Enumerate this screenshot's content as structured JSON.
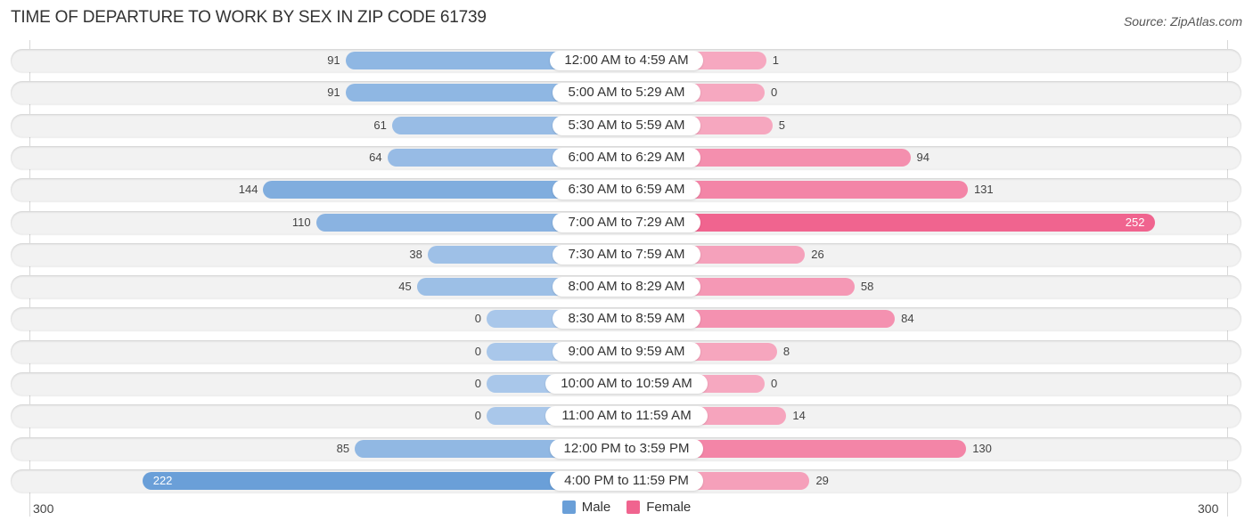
{
  "header": {
    "title": "TIME OF DEPARTURE TO WORK BY SEX IN ZIP CODE 61739",
    "source": "Source: ZipAtlas.com"
  },
  "colors": {
    "male": "#6a9fd8",
    "male_light": "#a9c7ea",
    "female": "#f0648f",
    "female_light": "#f6a8c0"
  },
  "chart_data": {
    "type": "bar",
    "orientation": "horizontal-diverging",
    "title": "TIME OF DEPARTURE TO WORK BY SEX IN ZIP CODE 61739",
    "categories": [
      "12:00 AM to 4:59 AM",
      "5:00 AM to 5:29 AM",
      "5:30 AM to 5:59 AM",
      "6:00 AM to 6:29 AM",
      "6:30 AM to 6:59 AM",
      "7:00 AM to 7:29 AM",
      "7:30 AM to 7:59 AM",
      "8:00 AM to 8:29 AM",
      "8:30 AM to 8:59 AM",
      "9:00 AM to 9:59 AM",
      "10:00 AM to 10:59 AM",
      "11:00 AM to 11:59 AM",
      "12:00 PM to 3:59 PM",
      "4:00 PM to 11:59 PM"
    ],
    "series": [
      {
        "name": "Male",
        "values": [
          91,
          91,
          61,
          64,
          144,
          110,
          38,
          45,
          0,
          0,
          0,
          0,
          85,
          222
        ]
      },
      {
        "name": "Female",
        "values": [
          1,
          0,
          5,
          94,
          131,
          252,
          26,
          58,
          84,
          8,
          0,
          14,
          130,
          29
        ]
      }
    ],
    "axis": {
      "left_tick": "300",
      "right_tick": "300",
      "range": [
        0,
        300
      ]
    },
    "legend": {
      "position": "bottom-center",
      "entries": [
        "Male",
        "Female"
      ]
    },
    "xlabel": "",
    "ylabel": ""
  }
}
